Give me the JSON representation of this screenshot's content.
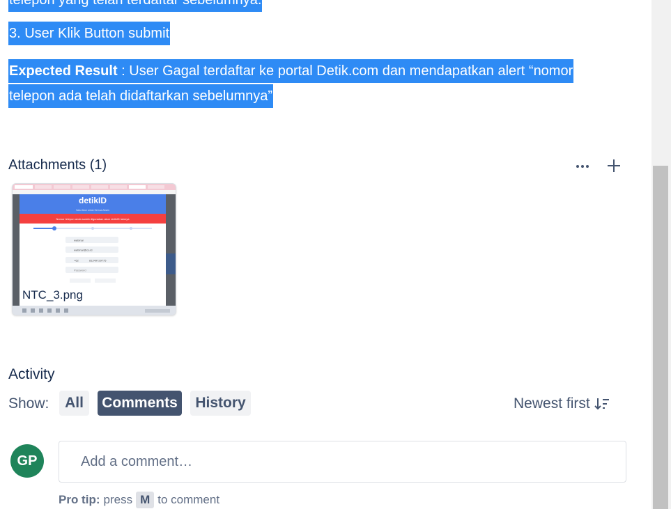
{
  "description": {
    "line_top_partial": "telepon yang telah terdaftar sebelumnya.",
    "step3": "3. User Klik Button submit",
    "expected_label": "Expected Result",
    "expected_text": " : User Gagal terdaftar ke portal Detik.com dan mendapatkan alert “nomor",
    "expected_text2": "telepon ada telah didaftarkan sebelumnya”"
  },
  "attachments": {
    "title": "Attachments (1)",
    "more_icon": "more-horizontal-icon",
    "add_icon": "plus-icon",
    "items": [
      {
        "filename": "NTC_3.png",
        "preview": {
          "brand": "detikID",
          "tagline": "Satu Akun untuk Semua Akses",
          "alert": "Nomor telepon anda sudah digunakan akun detikID lainnya",
          "field_name": "webinar",
          "field_email": "webinar@co.id",
          "field_country": "+62",
          "field_phone": "81249729775",
          "field_password": "Password"
        }
      }
    ]
  },
  "activity": {
    "title": "Activity",
    "show_label": "Show:",
    "filters": [
      {
        "label": "All",
        "active": false
      },
      {
        "label": "Comments",
        "active": true
      },
      {
        "label": "History",
        "active": false
      }
    ],
    "sort_label": "Newest first",
    "sort_icon": "sort-descending-icon"
  },
  "comment": {
    "avatar_initials": "GP",
    "placeholder": "Add a comment…",
    "protip_label": "Pro tip:",
    "protip_pre": "press",
    "protip_key": "M",
    "protip_post": "to comment"
  },
  "colors": {
    "selection": "#2e8bf5",
    "avatar": "#1f845a",
    "active_pill": "#44546f",
    "alert_red": "#f44040",
    "brand_blue": "#4a7fe8"
  }
}
